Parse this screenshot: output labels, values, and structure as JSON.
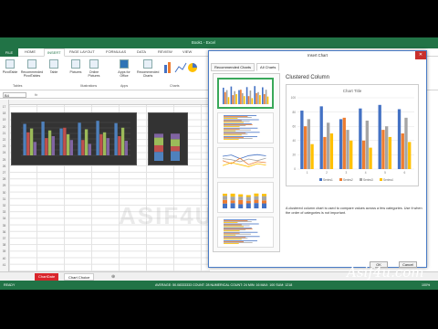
{
  "app": {
    "window_title": "Book1 - Excel",
    "ribbon_tabs": [
      "FILE",
      "HOME",
      "INSERT",
      "PAGE LAYOUT",
      "FORMULAS",
      "DATA",
      "REVIEW",
      "VIEW"
    ],
    "active_tab": "INSERT"
  },
  "ribbon": {
    "buttons": [
      {
        "label": "PivotTable"
      },
      {
        "label": "Recommended PivotTables"
      },
      {
        "label": "Table"
      },
      {
        "label": "Pictures"
      },
      {
        "label": "Online Pictures"
      },
      {
        "label": "Apps for Office"
      },
      {
        "label": "Recommended Charts"
      }
    ],
    "groups": [
      "Tables",
      "Illustrations",
      "Apps",
      "Charts"
    ]
  },
  "formula_bar": {
    "name_box": "B4",
    "fx": "fx"
  },
  "row_numbers": [
    "17",
    "18",
    "19",
    "20",
    "21",
    "22",
    "23",
    "24",
    "25",
    "26",
    "27",
    "28",
    "29",
    "30",
    "31",
    "32",
    "33",
    "34",
    "35",
    "36",
    "37",
    "38",
    "39",
    "40",
    "41"
  ],
  "sheet_tabs": [
    {
      "label": "ChartDate",
      "color": "#d9262c",
      "text_color": "#ffffff"
    },
    {
      "label": "Chart Choice",
      "color": "#ffffff",
      "text_color": "#222222"
    }
  ],
  "status_bar": {
    "ready": "READY",
    "stats": "AVERAGE: 50.08333333   COUNT: 28   NUMERICAL COUNT: 24   MIN: 16   MAX: 100   SUM: 1218",
    "zoom": "100%"
  },
  "dialog": {
    "title": "Insert Chart",
    "close": "✕",
    "tabs": [
      "Recommended Charts",
      "All Charts"
    ],
    "selected_chart_name": "Clustered Column",
    "description": "A clustered column chart is used to compare values across a few categories. Use it when the order of categories is not important.",
    "ok": "OK",
    "cancel": "Cancel"
  },
  "chart_data": {
    "type": "bar",
    "title": "Chart Title",
    "categories": [
      "1",
      "2",
      "3",
      "4",
      "5",
      "6"
    ],
    "series": [
      {
        "name": "Series1",
        "color": "#4472c4",
        "values": [
          82,
          88,
          70,
          85,
          90,
          84
        ]
      },
      {
        "name": "Series2",
        "color": "#ed7d31",
        "values": [
          60,
          45,
          72,
          40,
          55,
          50
        ]
      },
      {
        "name": "Series3",
        "color": "#a5a5a5",
        "values": [
          70,
          65,
          55,
          68,
          60,
          72
        ]
      },
      {
        "name": "Series4",
        "color": "#ffc000",
        "values": [
          35,
          50,
          40,
          30,
          45,
          38
        ]
      }
    ],
    "ylim": [
      0,
      100
    ],
    "grid": true,
    "legend": "bottom"
  },
  "watermark": "ASIF4U.COM",
  "brand": "Asif4u.com"
}
